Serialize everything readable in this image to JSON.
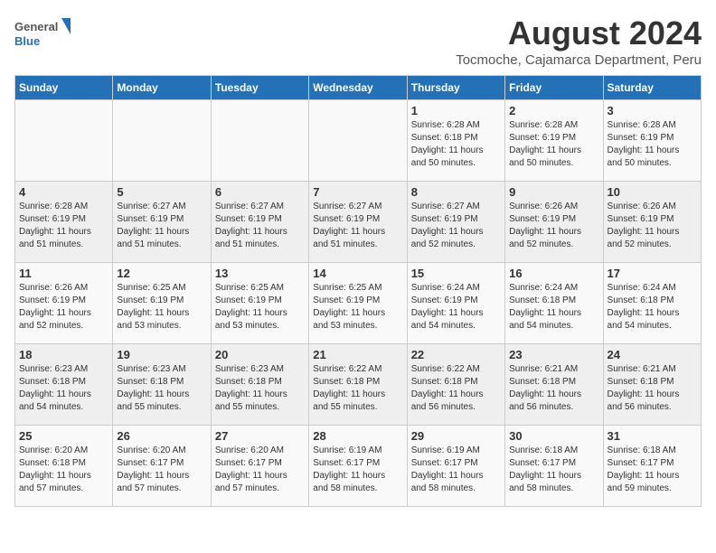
{
  "logo": {
    "line1": "General",
    "line2": "Blue"
  },
  "title": "August 2024",
  "subtitle": "Tocmoche, Cajamarca Department, Peru",
  "headers": [
    "Sunday",
    "Monday",
    "Tuesday",
    "Wednesday",
    "Thursday",
    "Friday",
    "Saturday"
  ],
  "weeks": [
    [
      {
        "day": "",
        "info": ""
      },
      {
        "day": "",
        "info": ""
      },
      {
        "day": "",
        "info": ""
      },
      {
        "day": "",
        "info": ""
      },
      {
        "day": "1",
        "info": "Sunrise: 6:28 AM\nSunset: 6:18 PM\nDaylight: 11 hours\nand 50 minutes."
      },
      {
        "day": "2",
        "info": "Sunrise: 6:28 AM\nSunset: 6:19 PM\nDaylight: 11 hours\nand 50 minutes."
      },
      {
        "day": "3",
        "info": "Sunrise: 6:28 AM\nSunset: 6:19 PM\nDaylight: 11 hours\nand 50 minutes."
      }
    ],
    [
      {
        "day": "4",
        "info": "Sunrise: 6:28 AM\nSunset: 6:19 PM\nDaylight: 11 hours\nand 51 minutes."
      },
      {
        "day": "5",
        "info": "Sunrise: 6:27 AM\nSunset: 6:19 PM\nDaylight: 11 hours\nand 51 minutes."
      },
      {
        "day": "6",
        "info": "Sunrise: 6:27 AM\nSunset: 6:19 PM\nDaylight: 11 hours\nand 51 minutes."
      },
      {
        "day": "7",
        "info": "Sunrise: 6:27 AM\nSunset: 6:19 PM\nDaylight: 11 hours\nand 51 minutes."
      },
      {
        "day": "8",
        "info": "Sunrise: 6:27 AM\nSunset: 6:19 PM\nDaylight: 11 hours\nand 52 minutes."
      },
      {
        "day": "9",
        "info": "Sunrise: 6:26 AM\nSunset: 6:19 PM\nDaylight: 11 hours\nand 52 minutes."
      },
      {
        "day": "10",
        "info": "Sunrise: 6:26 AM\nSunset: 6:19 PM\nDaylight: 11 hours\nand 52 minutes."
      }
    ],
    [
      {
        "day": "11",
        "info": "Sunrise: 6:26 AM\nSunset: 6:19 PM\nDaylight: 11 hours\nand 52 minutes."
      },
      {
        "day": "12",
        "info": "Sunrise: 6:25 AM\nSunset: 6:19 PM\nDaylight: 11 hours\nand 53 minutes."
      },
      {
        "day": "13",
        "info": "Sunrise: 6:25 AM\nSunset: 6:19 PM\nDaylight: 11 hours\nand 53 minutes."
      },
      {
        "day": "14",
        "info": "Sunrise: 6:25 AM\nSunset: 6:19 PM\nDaylight: 11 hours\nand 53 minutes."
      },
      {
        "day": "15",
        "info": "Sunrise: 6:24 AM\nSunset: 6:19 PM\nDaylight: 11 hours\nand 54 minutes."
      },
      {
        "day": "16",
        "info": "Sunrise: 6:24 AM\nSunset: 6:18 PM\nDaylight: 11 hours\nand 54 minutes."
      },
      {
        "day": "17",
        "info": "Sunrise: 6:24 AM\nSunset: 6:18 PM\nDaylight: 11 hours\nand 54 minutes."
      }
    ],
    [
      {
        "day": "18",
        "info": "Sunrise: 6:23 AM\nSunset: 6:18 PM\nDaylight: 11 hours\nand 54 minutes."
      },
      {
        "day": "19",
        "info": "Sunrise: 6:23 AM\nSunset: 6:18 PM\nDaylight: 11 hours\nand 55 minutes."
      },
      {
        "day": "20",
        "info": "Sunrise: 6:23 AM\nSunset: 6:18 PM\nDaylight: 11 hours\nand 55 minutes."
      },
      {
        "day": "21",
        "info": "Sunrise: 6:22 AM\nSunset: 6:18 PM\nDaylight: 11 hours\nand 55 minutes."
      },
      {
        "day": "22",
        "info": "Sunrise: 6:22 AM\nSunset: 6:18 PM\nDaylight: 11 hours\nand 56 minutes."
      },
      {
        "day": "23",
        "info": "Sunrise: 6:21 AM\nSunset: 6:18 PM\nDaylight: 11 hours\nand 56 minutes."
      },
      {
        "day": "24",
        "info": "Sunrise: 6:21 AM\nSunset: 6:18 PM\nDaylight: 11 hours\nand 56 minutes."
      }
    ],
    [
      {
        "day": "25",
        "info": "Sunrise: 6:20 AM\nSunset: 6:18 PM\nDaylight: 11 hours\nand 57 minutes."
      },
      {
        "day": "26",
        "info": "Sunrise: 6:20 AM\nSunset: 6:17 PM\nDaylight: 11 hours\nand 57 minutes."
      },
      {
        "day": "27",
        "info": "Sunrise: 6:20 AM\nSunset: 6:17 PM\nDaylight: 11 hours\nand 57 minutes."
      },
      {
        "day": "28",
        "info": "Sunrise: 6:19 AM\nSunset: 6:17 PM\nDaylight: 11 hours\nand 58 minutes."
      },
      {
        "day": "29",
        "info": "Sunrise: 6:19 AM\nSunset: 6:17 PM\nDaylight: 11 hours\nand 58 minutes."
      },
      {
        "day": "30",
        "info": "Sunrise: 6:18 AM\nSunset: 6:17 PM\nDaylight: 11 hours\nand 58 minutes."
      },
      {
        "day": "31",
        "info": "Sunrise: 6:18 AM\nSunset: 6:17 PM\nDaylight: 11 hours\nand 59 minutes."
      }
    ]
  ]
}
